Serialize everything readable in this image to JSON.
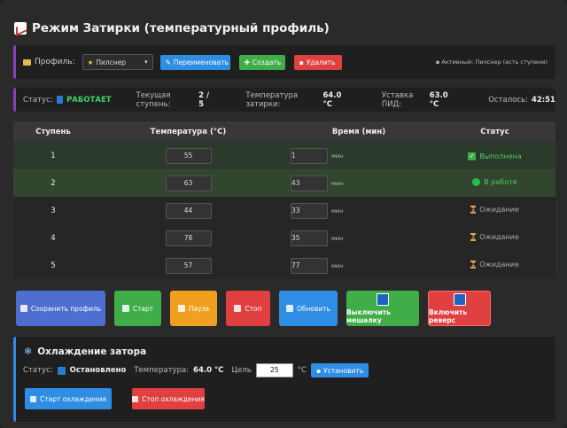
{
  "title": "Режим Затирки (температурный профиль)",
  "profile": {
    "label": "Профиль:",
    "selected": "Пилснер",
    "rename_label": "Переименовать",
    "create_label": "Создать",
    "delete_label": "Удалить",
    "active_info": "Активный: Пилснер (есть ступени)"
  },
  "status": {
    "label": "Статус:",
    "value": "РАБОТАЕТ",
    "step_label": "Текущая ступень:",
    "step_value": "2 / 5",
    "temp_label": "Температура затирки:",
    "temp_value": "64.0 °C",
    "pid_label": "Уставка ПИД:",
    "pid_value": "63.0 °C",
    "remaining_label": "Осталось:",
    "remaining_value": "42:51"
  },
  "table": {
    "headers": [
      "Ступень",
      "Температура (°C)",
      "Время (мин)",
      "Статус"
    ],
    "unit": "мин",
    "rows": [
      {
        "step": "1",
        "temp": "55",
        "time": "1",
        "status": "Выполнена"
      },
      {
        "step": "2",
        "temp": "63",
        "time": "43",
        "status": "В работе"
      },
      {
        "step": "3",
        "temp": "44",
        "time": "33",
        "status": "Ожидание"
      },
      {
        "step": "4",
        "temp": "78",
        "time": "35",
        "status": "Ожидание"
      },
      {
        "step": "5",
        "temp": "57",
        "time": "77",
        "status": "Ожидание"
      }
    ]
  },
  "actions": {
    "save": "Сохранить профиль",
    "start": "Старт",
    "pause": "Пауза",
    "stop": "Стоп",
    "refresh": "Обновить",
    "mixer_off": "Выключить мешалку",
    "reverse_on": "Включить реверс"
  },
  "cooling": {
    "title": "Охлаждение затора",
    "status_label": "Статус:",
    "status_value": "Остановлено",
    "temp_label": "Температура:",
    "temp_value": "64.0 °C",
    "target_label": "Цель",
    "target_value": "25",
    "target_unit": "°C",
    "set_label": "Установить",
    "start_label": "Старт охлаждения",
    "stop_label": "Стоп охлаждения"
  },
  "colors": {
    "accent_purple": "#8a3fb8",
    "accent_blue": "#2f8de4",
    "running_green": "#3fd16a"
  }
}
